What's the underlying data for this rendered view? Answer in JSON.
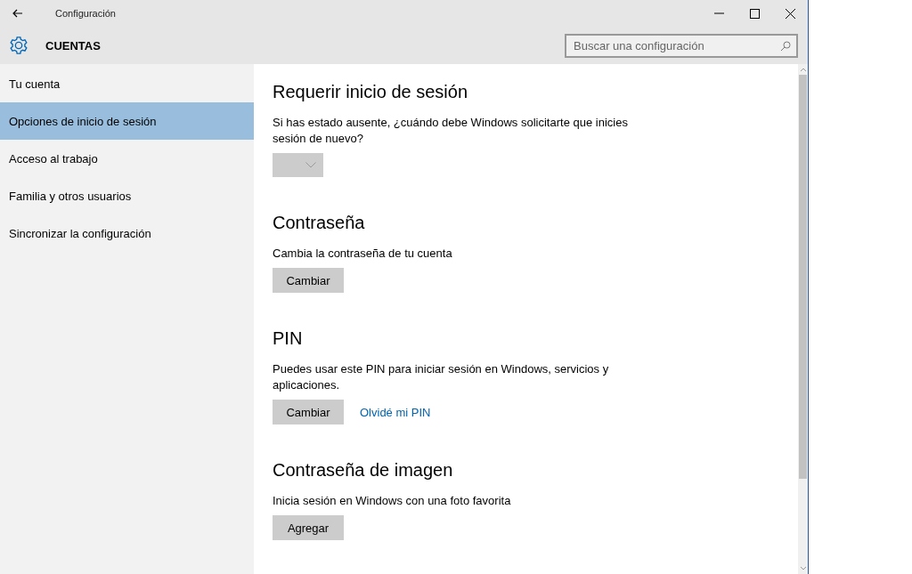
{
  "window": {
    "title": "Configuración"
  },
  "header": {
    "title": "CUENTAS",
    "search": {
      "placeholder": "Buscar una configuración"
    }
  },
  "sidebar": {
    "items": [
      {
        "label": "Tu cuenta",
        "selected": false
      },
      {
        "label": "Opciones de inicio de sesión",
        "selected": true
      },
      {
        "label": "Acceso al trabajo",
        "selected": false
      },
      {
        "label": "Familia y otros usuarios",
        "selected": false
      },
      {
        "label": "Sincronizar la configuración",
        "selected": false
      }
    ]
  },
  "sections": [
    {
      "title": "Requerir inicio de sesión",
      "description": "Si has estado ausente, ¿cuándo debe Windows solicitarte que inicies sesión de nuevo?",
      "controls": [
        {
          "kind": "dropdown"
        }
      ]
    },
    {
      "title": "Contraseña",
      "description": "Cambia la contraseña de tu cuenta",
      "controls": [
        {
          "kind": "button",
          "label": "Cambiar"
        }
      ]
    },
    {
      "title": "PIN",
      "description": "Puedes usar este PIN para iniciar sesión en Windows, servicios y aplicaciones.",
      "controls": [
        {
          "kind": "button",
          "label": "Cambiar"
        },
        {
          "kind": "link",
          "label": "Olvidé mi PIN"
        }
      ]
    },
    {
      "title": "Contraseña de imagen",
      "description": "Inicia sesión en Windows con una foto favorita",
      "controls": [
        {
          "kind": "button",
          "label": "Agregar"
        }
      ]
    }
  ]
}
